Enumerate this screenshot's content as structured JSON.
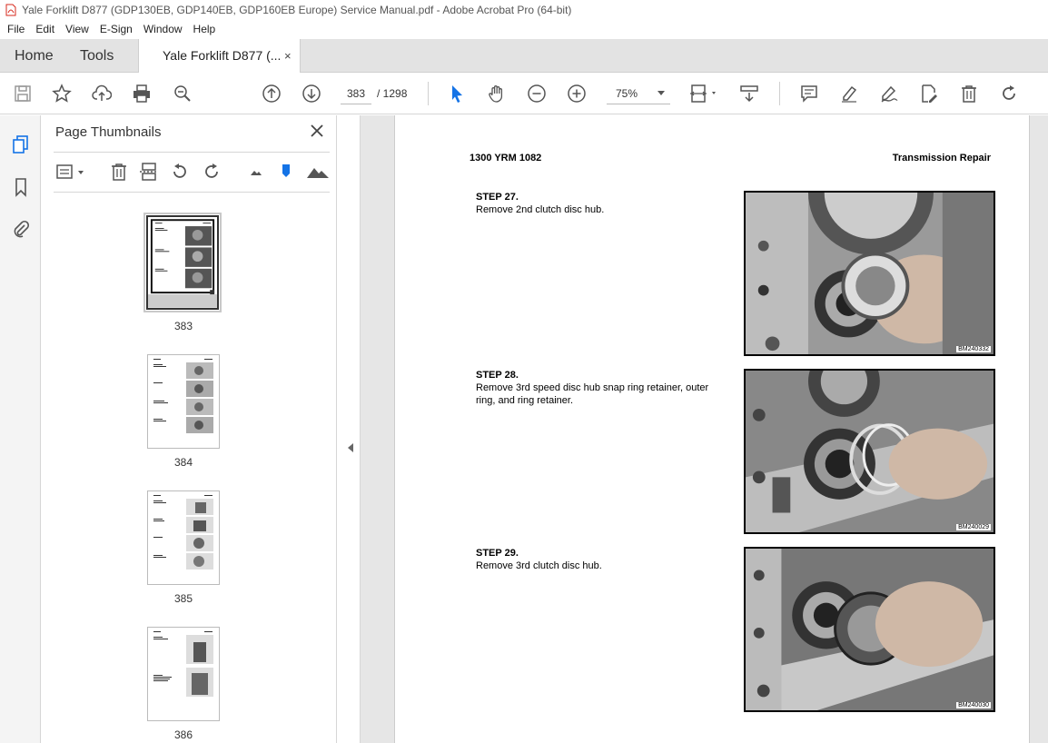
{
  "window": {
    "title": "Yale Forklift D877 (GDP130EB, GDP140EB, GDP160EB Europe) Service Manual.pdf - Adobe Acrobat Pro (64-bit)"
  },
  "menu": [
    "File",
    "Edit",
    "View",
    "E-Sign",
    "Window",
    "Help"
  ],
  "tabs": {
    "home": "Home",
    "tools": "Tools",
    "document": "Yale Forklift D877 (...",
    "close": "×"
  },
  "toolbar": {
    "page_current": "383",
    "page_total": "/  1298",
    "zoom": "75%",
    "icons": [
      "save-icon",
      "bookmark-star-icon",
      "upload-icon",
      "print-icon",
      "find-icon",
      "prev-page-icon",
      "next-page-icon",
      "select-icon",
      "hand-icon",
      "zoom-out-icon",
      "zoom-in-icon",
      "page-fit-icon",
      "scroll-mode-icon",
      "comment-icon",
      "highlight-icon",
      "sign-icon",
      "edit-pdf-icon",
      "delete-icon",
      "redo-icon"
    ]
  },
  "panel": {
    "title": "Page Thumbnails",
    "thumbnails": [
      {
        "label": "383",
        "selected": true
      },
      {
        "label": "384",
        "selected": false
      },
      {
        "label": "385",
        "selected": false
      },
      {
        "label": "386",
        "selected": false
      }
    ]
  },
  "page": {
    "header_left": "1300 YRM 1082",
    "header_right": "Transmission Repair",
    "steps": [
      {
        "title": "STEP 27.",
        "text": "Remove 2nd clutch disc hub.",
        "photo_id": "BM240332"
      },
      {
        "title": "STEP 28.",
        "text": "Remove 3rd speed disc hub snap ring retainer, outer ring, and ring retainer.",
        "photo_id": "BM240029"
      },
      {
        "title": "STEP 29.",
        "text": "Remove 3rd clutch disc hub.",
        "photo_id": "BM240030"
      }
    ]
  },
  "colors": {
    "accent_blue": "#1473e6",
    "acrobat_red": "#d7281c"
  }
}
